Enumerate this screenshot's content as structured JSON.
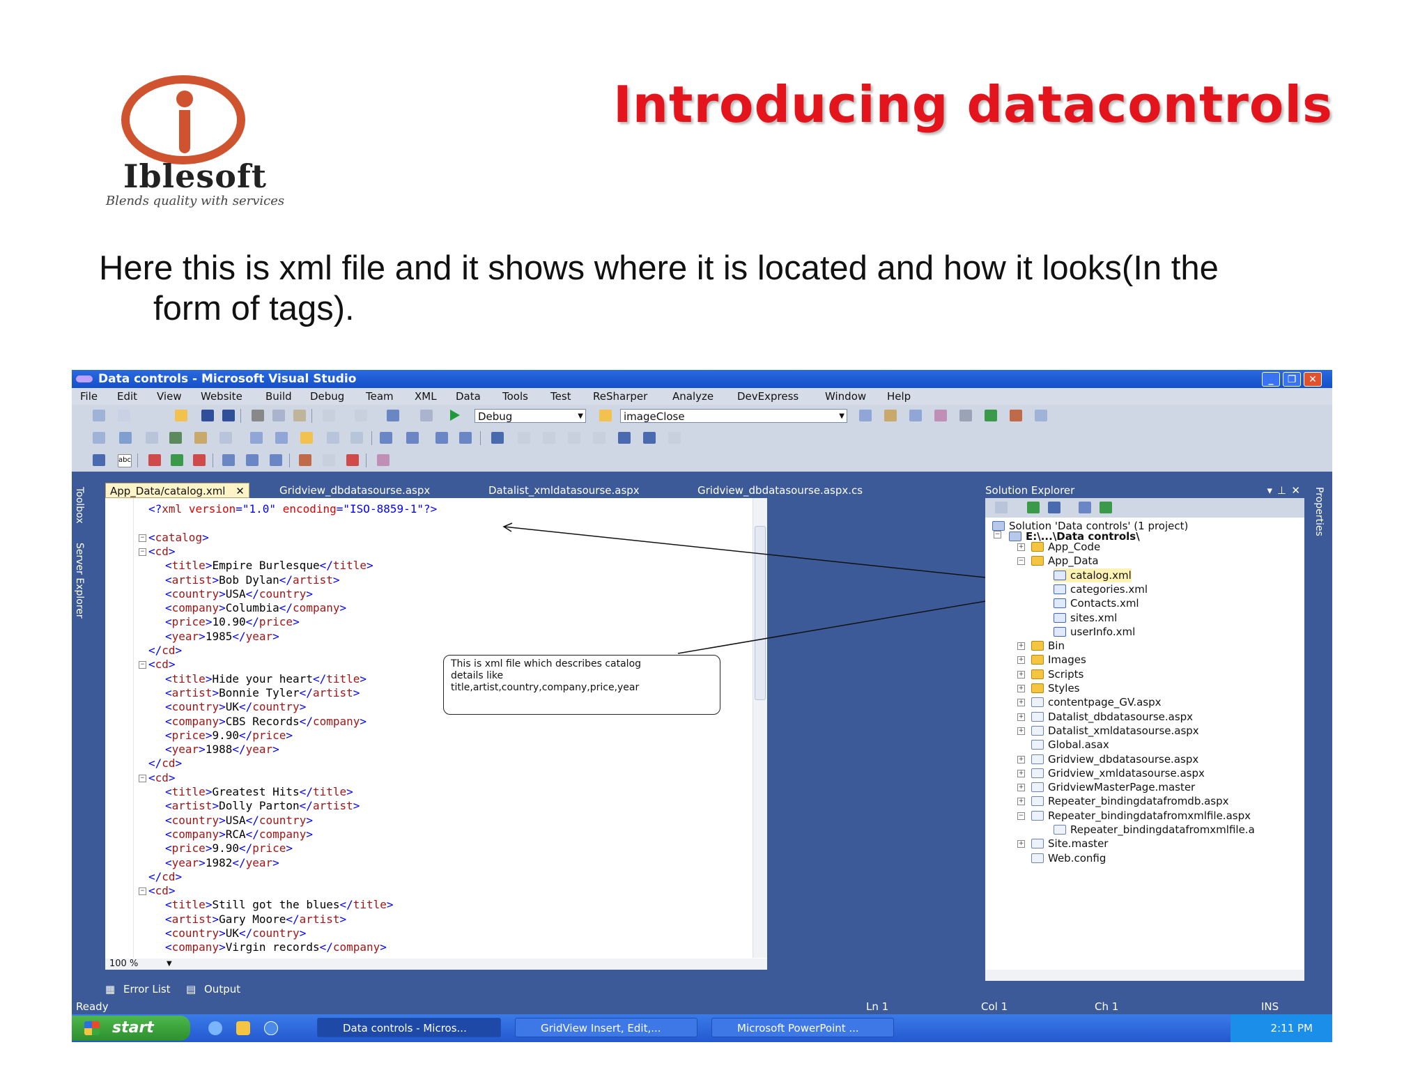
{
  "slide": {
    "title": "Introducing datacontrols",
    "logo": {
      "name": "Iblesoft",
      "tagline": "Blends quality with services"
    },
    "text_line1": "Here this is xml file and it shows where it is located and how it looks(In the",
    "text_line2": "form of tags)."
  },
  "window": {
    "title": "Data controls - Microsoft Visual Studio",
    "menu": [
      "File",
      "Edit",
      "View",
      "Website",
      "Build",
      "Debug",
      "Team",
      "XML",
      "Data",
      "Tools",
      "Test",
      "ReSharper",
      "Analyze",
      "DevExpress",
      "Window",
      "Help"
    ],
    "toolbar": {
      "config": "Debug",
      "find": "imageClose"
    },
    "left_rail": [
      "Toolbox",
      "Server Explorer"
    ],
    "right_rail": [
      "Properties"
    ]
  },
  "editor": {
    "tabs": [
      "App_Data/catalog.xml",
      "Gridview_dbdatasourse.aspx",
      "Datalist_xmldatasourse.aspx",
      "Gridview_dbdatasourse.aspx.cs"
    ],
    "zoom": "100 %",
    "xml_decl": {
      "version": "1.0",
      "encoding": "ISO-8859-1"
    },
    "root": "catalog",
    "cds": [
      {
        "title": "Empire Burlesque",
        "artist": "Bob Dylan",
        "country": "USA",
        "company": "Columbia",
        "price": "10.90",
        "year": "1985"
      },
      {
        "title": "Hide your heart",
        "artist": "Bonnie Tyler",
        "country": "UK",
        "company": "CBS Records",
        "price": "9.90",
        "year": "1988"
      },
      {
        "title": "Greatest Hits",
        "artist": "Dolly Parton",
        "country": "USA",
        "company": "RCA",
        "price": "9.90",
        "year": "1982"
      },
      {
        "title": "Still got the blues",
        "artist": "Gary Moore",
        "country": "UK",
        "company": "Virgin records"
      }
    ]
  },
  "callout": {
    "line1": "This is xml file which describes catalog",
    "line2": "details like",
    "line3": "title,artist,country,company,price,year"
  },
  "solution_explorer": {
    "title": "Solution Explorer",
    "solution": "Solution 'Data controls' (1 project)",
    "project": "E:\\...\\Data controls\\",
    "items": [
      {
        "name": "App_Code",
        "kind": "folder"
      },
      {
        "name": "App_Data",
        "kind": "folder"
      },
      {
        "name": "catalog.xml",
        "kind": "xml"
      },
      {
        "name": "categories.xml",
        "kind": "xml"
      },
      {
        "name": "Contacts.xml",
        "kind": "xml"
      },
      {
        "name": "sites.xml",
        "kind": "xml"
      },
      {
        "name": "userInfo.xml",
        "kind": "xml"
      },
      {
        "name": "Bin",
        "kind": "folder"
      },
      {
        "name": "Images",
        "kind": "folder"
      },
      {
        "name": "Scripts",
        "kind": "folder"
      },
      {
        "name": "Styles",
        "kind": "folder"
      },
      {
        "name": "contentpage_GV.aspx",
        "kind": "file"
      },
      {
        "name": "Datalist_dbdatasourse.aspx",
        "kind": "file"
      },
      {
        "name": "Datalist_xmldatasourse.aspx",
        "kind": "file"
      },
      {
        "name": "Global.asax",
        "kind": "file"
      },
      {
        "name": "Gridview_dbdatasourse.aspx",
        "kind": "file"
      },
      {
        "name": "Gridview_xmldatasourse.aspx",
        "kind": "file"
      },
      {
        "name": "GridviewMasterPage.master",
        "kind": "file"
      },
      {
        "name": "Repeater_bindingdatafromdb.aspx",
        "kind": "file"
      },
      {
        "name": "Repeater_bindingdatafromxmlfile.aspx",
        "kind": "file"
      },
      {
        "name": "Repeater_bindingdatafromxmlfile.a",
        "kind": "file"
      },
      {
        "name": "Site.master",
        "kind": "file"
      },
      {
        "name": "Web.config",
        "kind": "file"
      }
    ]
  },
  "bottom_tabs": [
    "Error List",
    "Output"
  ],
  "status": {
    "left": "Ready",
    "ln": "Ln 1",
    "col": "Col 1",
    "ch": "Ch 1",
    "mode": "INS"
  },
  "taskbar": {
    "start": "start",
    "items": [
      "Data controls - Micros...",
      "GridView Insert, Edit,...",
      "Microsoft PowerPoint ..."
    ],
    "time": "2:11 PM"
  }
}
